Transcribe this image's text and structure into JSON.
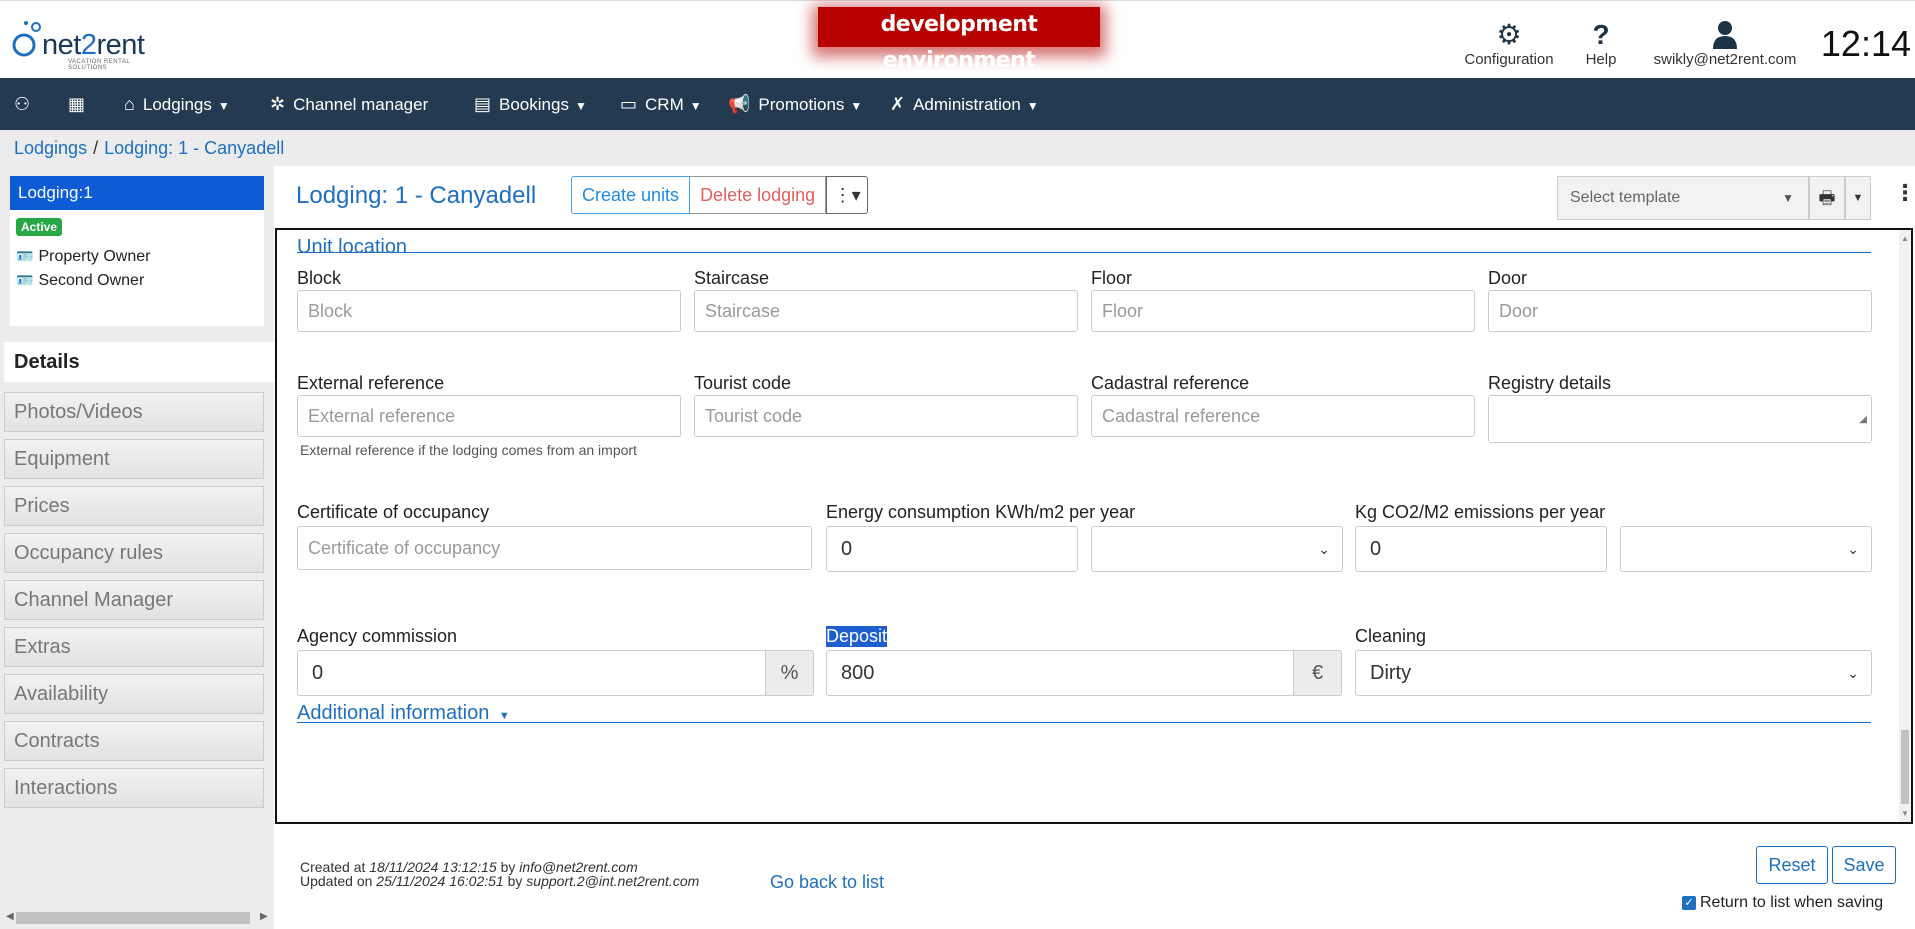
{
  "header": {
    "logo_text_a": "net",
    "logo_text_b": "2",
    "logo_text_c": "rent",
    "logo_tagline": "VACATION RENTAL SOLUTIONS",
    "env_banner": "development environment",
    "configuration_label": "Configuration",
    "help_label": "Help",
    "user_email": "swikly@net2rent.com",
    "clock": "12:14"
  },
  "nav": {
    "lodgings": "Lodgings",
    "channel_manager": "Channel manager",
    "bookings": "Bookings",
    "crm": "CRM",
    "promotions": "Promotions",
    "administration": "Administration"
  },
  "breadcrumb": {
    "root": "Lodgings",
    "separator": "/",
    "current": "Lodging: 1 - Canyadell"
  },
  "sidebar": {
    "lodging_label": "Lodging:1",
    "status_badge": "Active",
    "owners": [
      "Property Owner",
      "Second Owner"
    ],
    "active_tab": "Details",
    "tabs": [
      "Photos/Videos",
      "Equipment",
      "Prices",
      "Occupancy rules",
      "Channel Manager",
      "Extras",
      "Availability",
      "Contracts",
      "Interactions"
    ]
  },
  "toolbar": {
    "title": "Lodging: 1 - Canyadell",
    "create_units": "Create units",
    "delete_lodging": "Delete lodging",
    "template_placeholder": "Select template"
  },
  "form": {
    "unit_location_title": "Unit location",
    "block_label": "Block",
    "block_placeholder": "Block",
    "staircase_label": "Staircase",
    "staircase_placeholder": "Staircase",
    "floor_label": "Floor",
    "floor_placeholder": "Floor",
    "door_label": "Door",
    "door_placeholder": "Door",
    "external_ref_label": "External reference",
    "external_ref_placeholder": "External reference",
    "external_ref_help": "External reference if the lodging comes from an import",
    "tourist_code_label": "Tourist code",
    "tourist_code_placeholder": "Tourist code",
    "cadastral_label": "Cadastral reference",
    "cadastral_placeholder": "Cadastral reference",
    "registry_label": "Registry details",
    "registry_value": "",
    "certificate_label": "Certificate of occupancy",
    "certificate_placeholder": "Certificate of occupancy",
    "energy_label": "Energy consumption KWh/m2 per year",
    "energy_value": "0",
    "energy_select": "",
    "co2_label": "Kg CO2/M2 emissions per year",
    "co2_value": "0",
    "co2_select": "",
    "commission_label": "Agency commission",
    "commission_value": "0",
    "commission_unit": "%",
    "deposit_label": "Deposit",
    "deposit_value": "800",
    "deposit_unit": "€",
    "cleaning_label": "Cleaning",
    "cleaning_value": "Dirty",
    "additional_info_title": "Additional information"
  },
  "footer": {
    "created_prefix": "Created at",
    "created_date": "18/11/2024 13:12:15",
    "created_by_word": "by",
    "created_by": "info@net2rent.com",
    "updated_prefix": "Updated on",
    "updated_date": "25/11/2024 16:02:51",
    "updated_by_word": "by",
    "updated_by": "support.2@int.net2rent.com",
    "back_link": "Go back to list",
    "reset": "Reset",
    "save": "Save",
    "return_checkbox_label": "Return to list when saving",
    "return_checkbox_checked": true
  },
  "colors": {
    "nav_bg": "#243a51",
    "accent": "#1e6fc0",
    "env_banner": "#b70000",
    "active_badge": "#28a745",
    "selected_item": "#0d5cd6"
  }
}
